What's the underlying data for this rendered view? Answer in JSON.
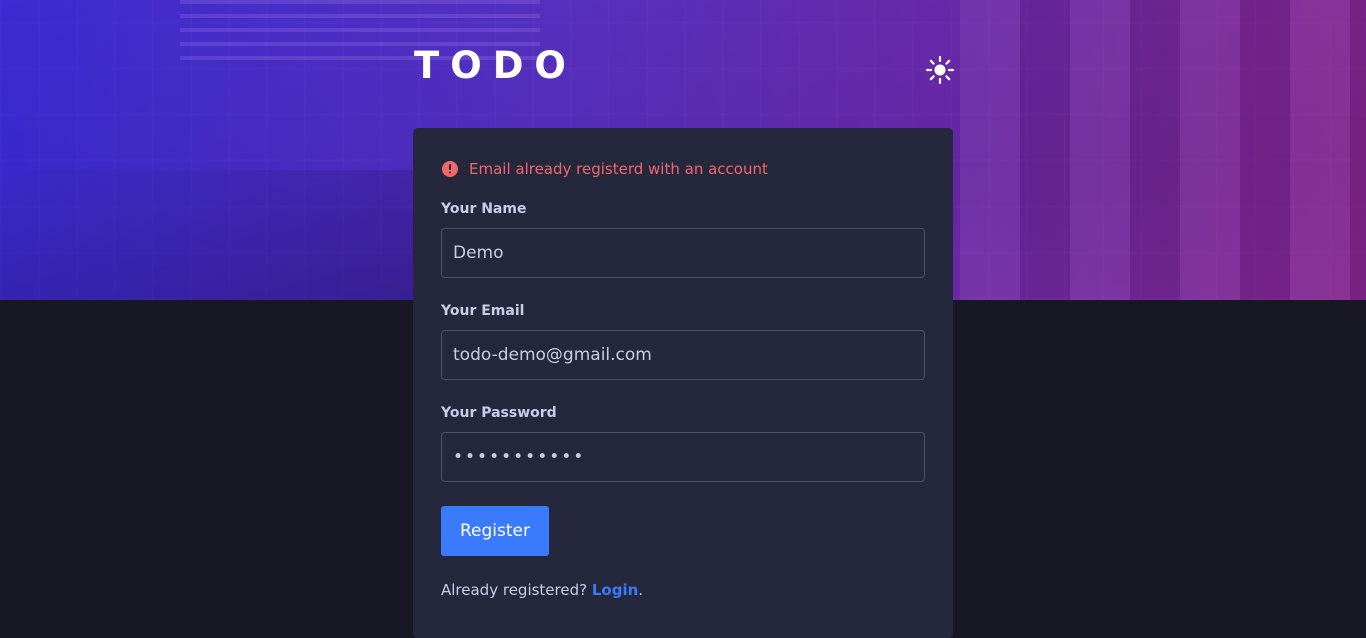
{
  "app": {
    "logo": "TODO",
    "theme_toggle_icon": "sun-icon"
  },
  "colors": {
    "accent": "#3a7bfd",
    "error": "#f0686a",
    "card_bg": "#25273c",
    "page_bg": "#181824"
  },
  "form": {
    "error_message": "Email already registerd with an account",
    "error_icon": "alert-circle-icon",
    "name": {
      "label": "Your Name",
      "value": "Demo"
    },
    "email": {
      "label": "Your Email",
      "value": "todo-demo@gmail.com"
    },
    "password": {
      "label": "Your Password",
      "value": "•••••••••••"
    },
    "register_label": "Register",
    "footer_text": "Already registered? ",
    "login_label": "Login",
    "footer_end": "."
  }
}
